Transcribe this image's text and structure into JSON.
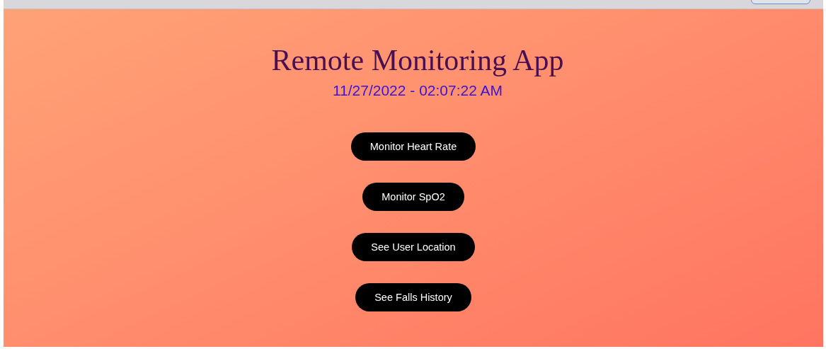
{
  "title": "Remote Monitoring App",
  "datetime": "11/27/2022 - 02:07:22 AM",
  "buttons": [
    "Monitor Heart Rate",
    "Monitor SpO2",
    "See User Location",
    "See Falls History"
  ]
}
